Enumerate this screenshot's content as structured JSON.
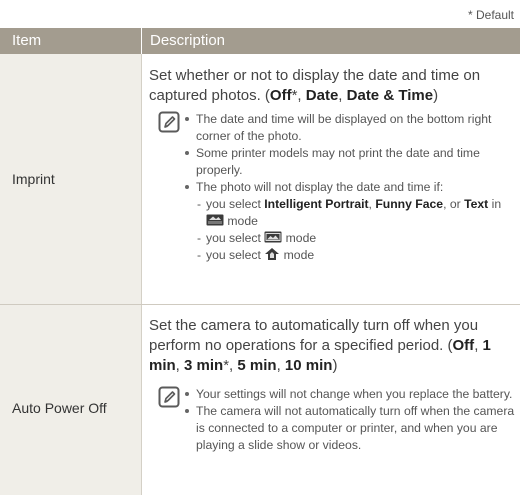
{
  "default_note": "* Default",
  "header": {
    "item": "Item",
    "description": "Description"
  },
  "rows": [
    {
      "item": "Imprint",
      "desc_text": "Set whether or not to display the date and time on captured photos.",
      "options": [
        "Off",
        "Date",
        "Date & Time"
      ],
      "notes": {
        "n1": "The date and time will be displayed on the bottom right corner of the photo.",
        "n2": "Some printer models may not print the date and time properly.",
        "n3": "The photo will not display the date and time if:",
        "sub1_prefix": "you select",
        "sub1_opt1": "Intelligent Portrait",
        "sub1_opt2": "Funny Face",
        "sub1_or": "or",
        "sub1_opt3": "Text",
        "sub1_in": "in",
        "mode": "mode",
        "sub2_prefix": "you select",
        "sub3_prefix": "you select"
      }
    },
    {
      "item": "Auto Power Off",
      "desc_text": "Set the camera to automatically turn off when you perform no operations for a specified period.",
      "options": [
        "Off",
        "1 min",
        "3 min",
        "5 min",
        "10 min"
      ],
      "notes": {
        "n1": "Your settings will not change when you replace the battery.",
        "n2": "The camera will not automatically turn off when the camera is connected to a computer or printer, and when you are playing a slide show or videos."
      }
    }
  ],
  "icons": [
    "note-pencil-icon",
    "scene-mode-icon",
    "panorama-mode-icon",
    "dual-is-mode-icon"
  ]
}
